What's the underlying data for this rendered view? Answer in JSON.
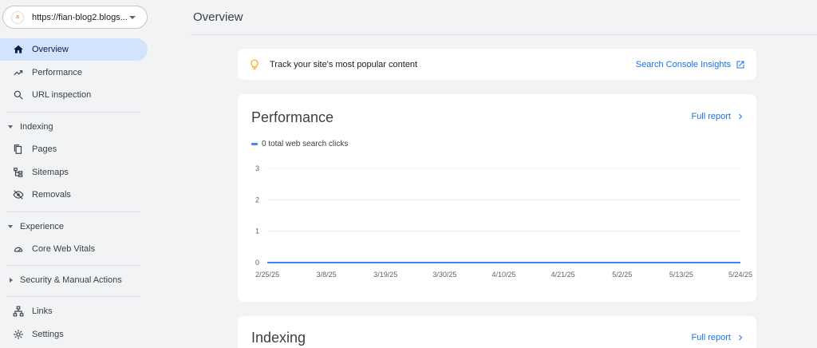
{
  "property": {
    "url": "https://fian-blog2.blogs...",
    "favicon": "a"
  },
  "nav": {
    "overview": "Overview",
    "performance": "Performance",
    "url_inspection": "URL inspection",
    "indexing_head": "Indexing",
    "pages": "Pages",
    "sitemaps": "Sitemaps",
    "removals": "Removals",
    "experience_head": "Experience",
    "core_web_vitals": "Core Web Vitals",
    "security_head": "Security & Manual Actions",
    "links": "Links",
    "settings": "Settings"
  },
  "header": {
    "title": "Overview"
  },
  "insights": {
    "text": "Track your site's most popular content",
    "link": "Search Console Insights"
  },
  "performance": {
    "title": "Performance",
    "link": "Full report"
  },
  "indexing": {
    "title": "Indexing",
    "link": "Full report"
  },
  "colors": {
    "accent": "#1a73e8",
    "active_nav": "#d3e3fd",
    "series": "#4285f4"
  },
  "chart_data": {
    "type": "line",
    "title": "",
    "xlabel": "",
    "ylabel": "",
    "ylim": [
      0,
      3
    ],
    "yticks": [
      "0",
      "1",
      "2",
      "3"
    ],
    "categories": [
      "2/25/25",
      "3/8/25",
      "3/19/25",
      "3/30/25",
      "4/10/25",
      "4/21/25",
      "5/2/25",
      "5/13/25",
      "5/24/25"
    ],
    "series": [
      {
        "name": "0 total web search clicks",
        "values": [
          0,
          0,
          0,
          0,
          0,
          0,
          0,
          0,
          0
        ]
      }
    ],
    "grid": true
  }
}
